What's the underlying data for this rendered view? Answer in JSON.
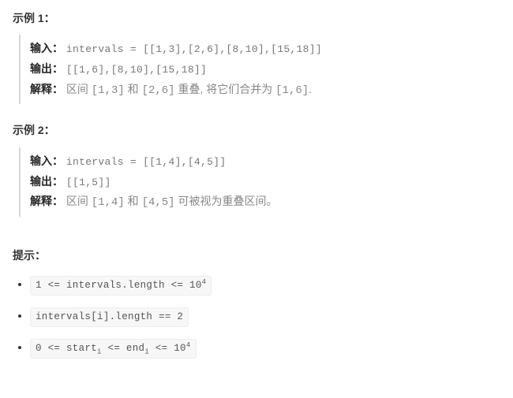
{
  "ex1": {
    "title": "示例 1：",
    "input_label": "输入：",
    "input_code": "intervals = [[1,3],[2,6],[8,10],[15,18]]",
    "output_label": "输出：",
    "output_code": "[[1,6],[8,10],[15,18]]",
    "explain_label": "解释：",
    "explain_p1": "区间 ",
    "explain_c1": "[1,3]",
    "explain_p2": " 和 ",
    "explain_c2": "[2,6]",
    "explain_p3": " 重叠, 将它们合并为 ",
    "explain_c3": "[1,6]",
    "explain_p4": "."
  },
  "ex2": {
    "title": "示例 2：",
    "input_label": "输入：",
    "input_code": "intervals = [[1,4],[4,5]]",
    "output_label": "输出：",
    "output_code": "[[1,5]]",
    "explain_label": "解释：",
    "explain_p1": "区间 ",
    "explain_c1": "[1,4]",
    "explain_p2": " 和 ",
    "explain_c2": "[4,5]",
    "explain_p3": " 可被视为重叠区间。"
  },
  "hints": {
    "title": "提示：",
    "items": [
      {
        "pre": "1 <= intervals.length <= 10",
        "sup": "4"
      },
      {
        "pre": "intervals[i].length == 2"
      },
      {
        "pre": "0 <= start",
        "sub1": "i",
        "mid": " <= end",
        "sub2": "i",
        "post": " <= 10",
        "sup": "4"
      }
    ]
  }
}
